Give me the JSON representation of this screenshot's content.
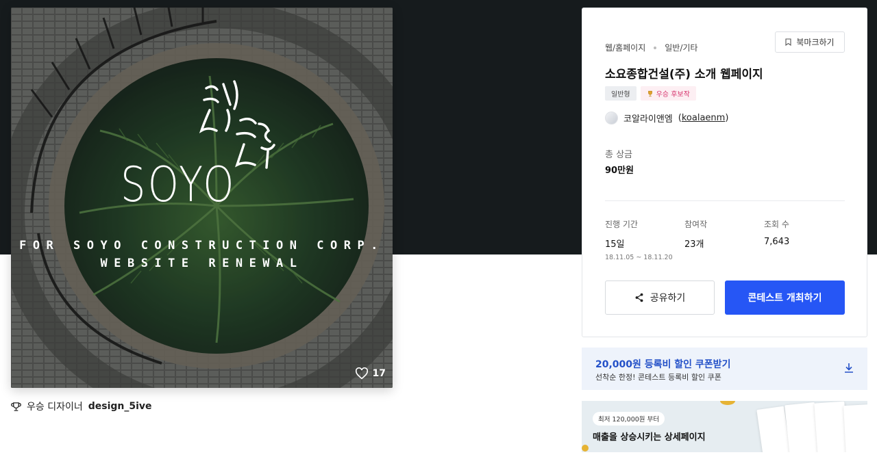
{
  "artwork": {
    "logo_text": "SOYO",
    "tagline_1": "FOR SOYO CONSTRUCTION CORP.",
    "tagline_2": "WEBSITE RENEWAL",
    "likes": "17"
  },
  "designer": {
    "label": "우승 디자이너",
    "name": "design_5ive"
  },
  "contest": {
    "category_1": "웹/홈페이지",
    "category_2": "일반/기타",
    "bookmark_label": "북마크하기",
    "title": "소요종합건설(주) 소개 웹페이지",
    "badge_type": "일반형",
    "badge_award": "우승 후보작",
    "host_name": "코알라이앤엠",
    "host_id": "koalaenm",
    "prize_label": "총 상금",
    "prize_value": "90만원",
    "stats": [
      {
        "label": "진행 기간",
        "value": "15일",
        "sub": "18.11.05 ~ 18.11.20"
      },
      {
        "label": "참여작",
        "value": "23개",
        "sub": ""
      },
      {
        "label": "조회 수",
        "value": "7,643",
        "sub": ""
      }
    ],
    "share_label": "공유하기",
    "host_button_label": "콘테스트 개최하기"
  },
  "coupon": {
    "title": "20,000원 등록비 할인 쿠폰받기",
    "subtitle": "선착순 한정! 콘테스트 등록비 할인 쿠폰"
  },
  "ad": {
    "pill": "최저 120,000원 부터",
    "title": "매출을 상승시키는 상세페이지"
  },
  "colors": {
    "primary": "#2656f5",
    "hero_bg": "#161b1d",
    "coupon_text": "#2350c8",
    "award_badge": "#d6336c"
  }
}
